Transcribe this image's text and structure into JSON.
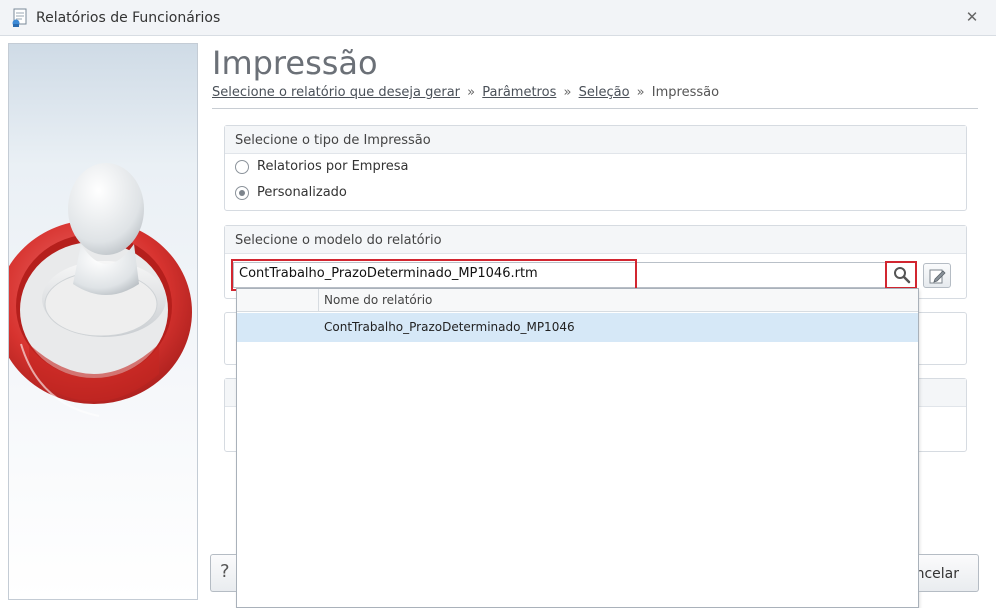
{
  "window": {
    "title": "Relatórios de Funcionários",
    "close_glyph": "✕"
  },
  "header": {
    "title": "Impressão",
    "breadcrumb": {
      "step1": "Selecione o relatório que deseja gerar",
      "sep": "»",
      "step2": "Parâmetros",
      "step3": "Seleção",
      "current": "Impressão"
    }
  },
  "print_type": {
    "title": "Selecione o tipo de Impressão",
    "options": [
      {
        "label": "Relatorios por Empresa",
        "selected": false
      },
      {
        "label": "Personalizado",
        "selected": true
      }
    ]
  },
  "report_model": {
    "title": "Selecione o modelo do relatório",
    "value": "ContTrabalho_PrazoDeterminado_MP1046.rtm",
    "search_icon": "magnifier-icon",
    "edit_icon": "edit-document-icon"
  },
  "dropdown": {
    "column_header": "Nome do relatório",
    "rows": [
      {
        "name": "ContTrabalho_PrazoDeterminado_MP1046"
      }
    ]
  },
  "footer": {
    "help_label": "?",
    "cancel_label": "Cancelar"
  },
  "colors": {
    "highlight_red": "#d22630",
    "selected_row": "#d6e8f7"
  }
}
